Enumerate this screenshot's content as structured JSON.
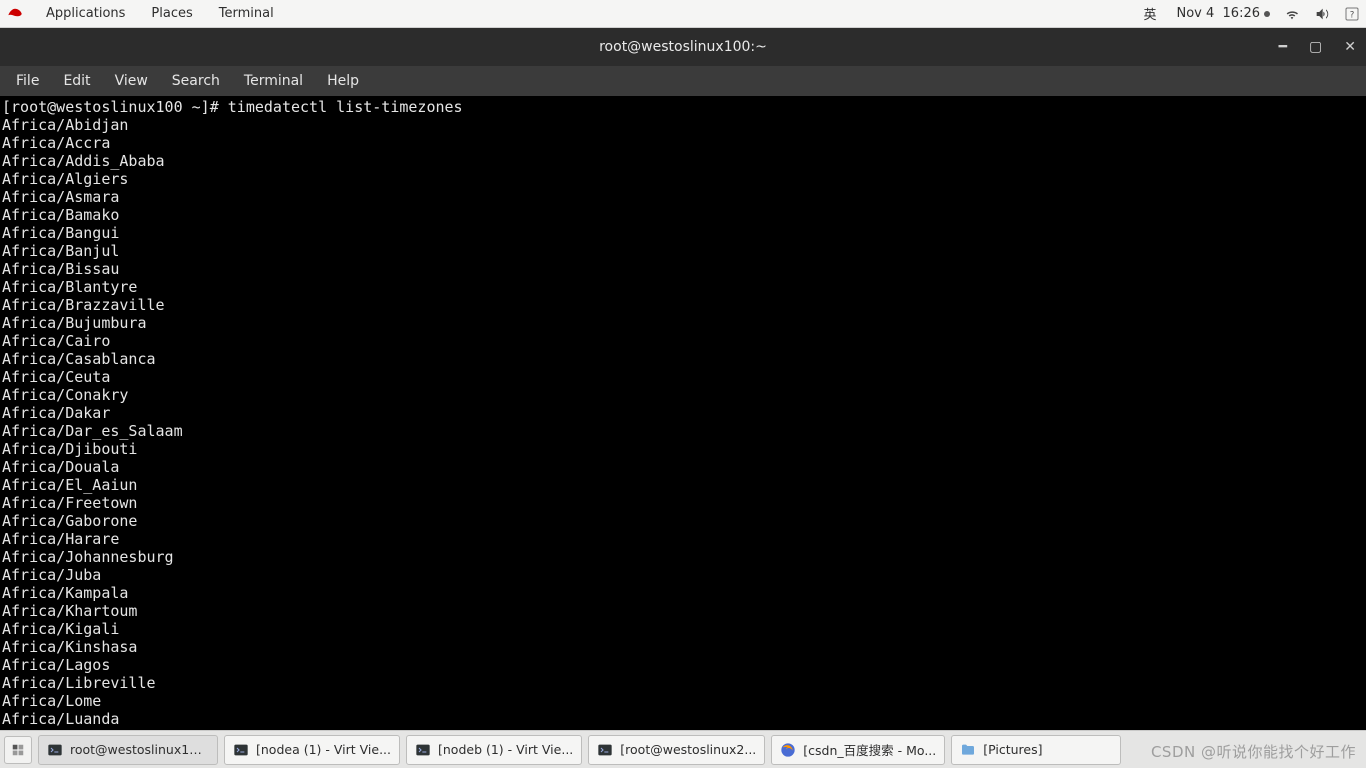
{
  "topbar": {
    "applications": "Applications",
    "places": "Places",
    "terminal_menu": "Terminal",
    "ime": "英",
    "date": "Nov 4",
    "time": "16:26"
  },
  "window": {
    "title": "root@westoslinux100:~"
  },
  "menubar": {
    "file": "File",
    "edit": "Edit",
    "view": "View",
    "search": "Search",
    "terminal": "Terminal",
    "help": "Help"
  },
  "terminal": {
    "prompt": "[root@westoslinux100 ~]# ",
    "command": "timedatectl list-timezones",
    "output": [
      "Africa/Abidjan",
      "Africa/Accra",
      "Africa/Addis_Ababa",
      "Africa/Algiers",
      "Africa/Asmara",
      "Africa/Bamako",
      "Africa/Bangui",
      "Africa/Banjul",
      "Africa/Bissau",
      "Africa/Blantyre",
      "Africa/Brazzaville",
      "Africa/Bujumbura",
      "Africa/Cairo",
      "Africa/Casablanca",
      "Africa/Ceuta",
      "Africa/Conakry",
      "Africa/Dakar",
      "Africa/Dar_es_Salaam",
      "Africa/Djibouti",
      "Africa/Douala",
      "Africa/El_Aaiun",
      "Africa/Freetown",
      "Africa/Gaborone",
      "Africa/Harare",
      "Africa/Johannesburg",
      "Africa/Juba",
      "Africa/Kampala",
      "Africa/Khartoum",
      "Africa/Kigali",
      "Africa/Kinshasa",
      "Africa/Lagos",
      "Africa/Libreville",
      "Africa/Lome",
      "Africa/Luanda"
    ]
  },
  "taskbar": {
    "items": [
      {
        "label": "root@westoslinux10...",
        "icon": "terminal-icon",
        "active": true
      },
      {
        "label": "[nodea (1) - Virt Vie...",
        "icon": "terminal-icon",
        "active": false
      },
      {
        "label": "[nodeb (1) - Virt Vie...",
        "icon": "terminal-icon",
        "active": false
      },
      {
        "label": "[root@westoslinux2...",
        "icon": "terminal-icon",
        "active": false
      },
      {
        "label": "[csdn_百度搜索 - Mo...",
        "icon": "firefox-icon",
        "active": false
      },
      {
        "label": "[Pictures]",
        "icon": "folder-icon",
        "active": false
      }
    ]
  },
  "watermark": "CSDN @听说你能找个好工作"
}
